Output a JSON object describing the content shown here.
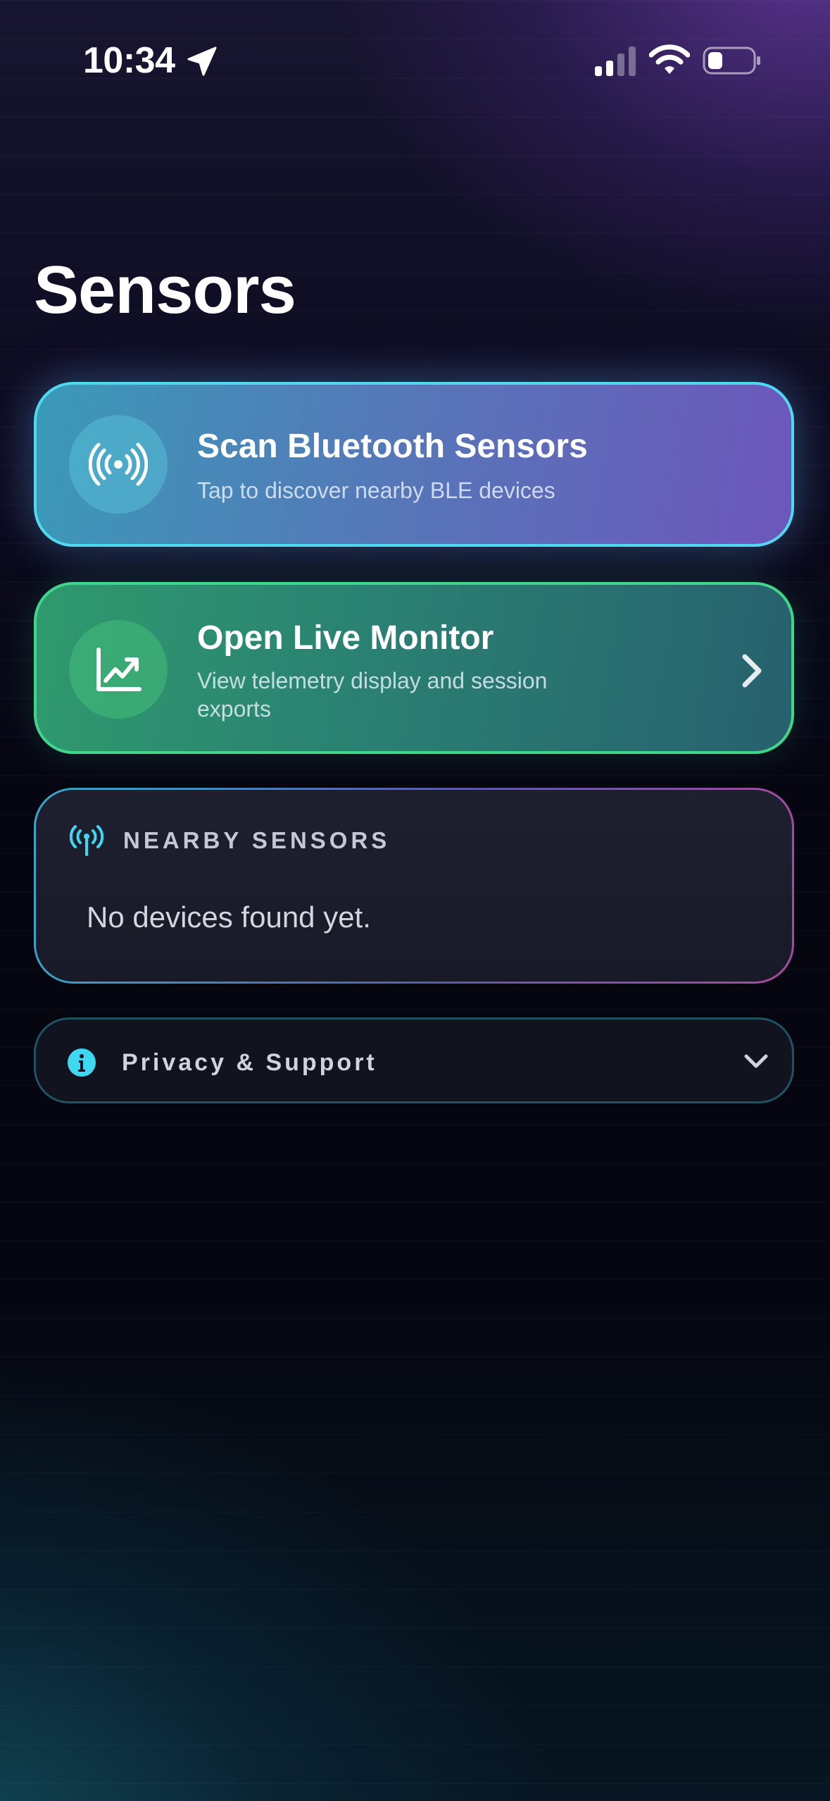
{
  "status_bar": {
    "time": "10:34",
    "icons": [
      "location-arrow-icon",
      "cellular-signal-icon",
      "wifi-icon",
      "battery-icon"
    ]
  },
  "page": {
    "title": "Sensors"
  },
  "scan_card": {
    "title": "Scan Bluetooth Sensors",
    "subtitle": "Tap to discover nearby BLE devices",
    "icon": "broadcast-signal-icon"
  },
  "monitor_card": {
    "title": "Open Live Monitor",
    "subtitle": "View telemetry display and session exports",
    "icon": "chart-line-up-icon"
  },
  "nearby": {
    "label": "NEARBY SENSORS",
    "empty_text": "No devices found yet.",
    "icon": "antenna-icon"
  },
  "privacy": {
    "label": "Privacy & Support",
    "icon": "info-icon"
  },
  "colors": {
    "scan_border": "#4fd8f0",
    "monitor_border": "#3fd68a",
    "accent_cyan": "#3fd8f0"
  }
}
